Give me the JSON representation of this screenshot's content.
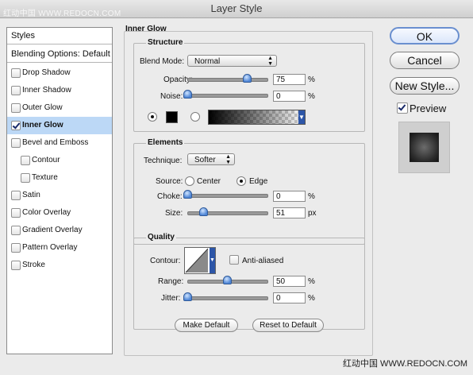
{
  "window": {
    "title": "Layer Style",
    "watermark_top": "红动中国 WWW.REDOCN.COM",
    "watermark_bottom": "红动中国 WWW.REDOCN.COM"
  },
  "sidebar": {
    "styles_header": "Styles",
    "blending_header": "Blending Options: Default",
    "items": [
      {
        "label": "Drop Shadow",
        "checked": false,
        "indent": false
      },
      {
        "label": "Inner Shadow",
        "checked": false,
        "indent": false
      },
      {
        "label": "Outer Glow",
        "checked": false,
        "indent": false
      },
      {
        "label": "Inner Glow",
        "checked": true,
        "indent": false,
        "selected": true
      },
      {
        "label": "Bevel and Emboss",
        "checked": false,
        "indent": false
      },
      {
        "label": "Contour",
        "checked": false,
        "indent": true
      },
      {
        "label": "Texture",
        "checked": false,
        "indent": true
      },
      {
        "label": "Satin",
        "checked": false,
        "indent": false
      },
      {
        "label": "Color Overlay",
        "checked": false,
        "indent": false
      },
      {
        "label": "Gradient Overlay",
        "checked": false,
        "indent": false
      },
      {
        "label": "Pattern Overlay",
        "checked": false,
        "indent": false
      },
      {
        "label": "Stroke",
        "checked": false,
        "indent": false
      }
    ]
  },
  "panel": {
    "title": "Inner Glow",
    "structure": {
      "title": "Structure",
      "blend_mode_label": "Blend Mode:",
      "blend_mode_value": "Normal",
      "opacity_label": "Opacity:",
      "opacity_value": "75",
      "opacity_pct": 75,
      "noise_label": "Noise:",
      "noise_value": "0",
      "noise_pct": 0,
      "unit": "%",
      "color": "#000000",
      "fill_mode": "color"
    },
    "elements": {
      "title": "Elements",
      "technique_label": "Technique:",
      "technique_value": "Softer",
      "source_label": "Source:",
      "source_center": "Center",
      "source_edge": "Edge",
      "source_selected": "Edge",
      "choke_label": "Choke:",
      "choke_value": "0",
      "choke_pct": 0,
      "choke_unit": "%",
      "size_label": "Size:",
      "size_value": "51",
      "size_fraction": 0.2,
      "size_unit": "px"
    },
    "quality": {
      "title": "Quality",
      "contour_label": "Contour:",
      "antialiased_label": "Anti-aliased",
      "antialiased": false,
      "range_label": "Range:",
      "range_value": "50",
      "range_pct": 50,
      "jitter_label": "Jitter:",
      "jitter_value": "0",
      "jitter_pct": 0,
      "unit": "%"
    },
    "buttons": {
      "make_default": "Make Default",
      "reset_default": "Reset to Default"
    }
  },
  "actions": {
    "ok": "OK",
    "cancel": "Cancel",
    "new_style": "New Style...",
    "preview_label": "Preview",
    "preview_checked": true
  },
  "colors": {
    "selection": "#bcd8f6",
    "slider_knob": "#4f86d6"
  }
}
